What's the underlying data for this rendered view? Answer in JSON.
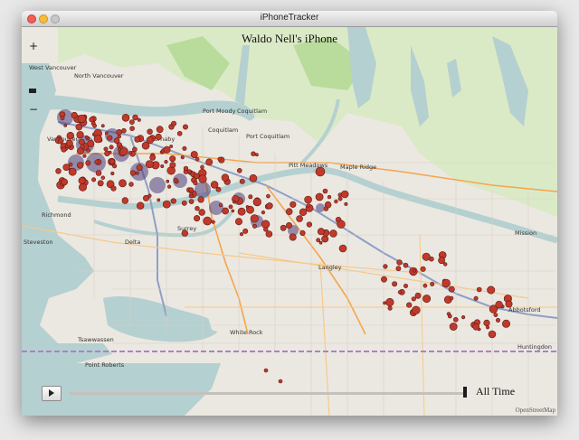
{
  "window": {
    "title": "iPhoneTracker"
  },
  "map": {
    "heading": "Waldo Nell's iPhone",
    "zoom_in_label": "+",
    "zoom_out_label": "−",
    "attribution": "OpenStreetMap",
    "colors": {
      "land": "#ebe8e1",
      "water": "#b5d0d0",
      "park": "#cdebb0",
      "highway": "#8da0c7",
      "trunk": "#f6a44b",
      "border": "#b07dc9",
      "dot_fill": "#c0392b",
      "cluster": "#4c3c7c"
    },
    "place_labels": [
      "Vancouver",
      "North Vancouver",
      "West Vancouver",
      "Burnaby",
      "Coquitlam",
      "Port Moody",
      "Port Coquitlam",
      "Pitt Meadows",
      "Maple Ridge",
      "Richmond",
      "Delta",
      "Surrey",
      "Langley",
      "White Rock",
      "Abbotsford",
      "Mission",
      "Steveston",
      "Tsawwassen",
      "Point Roberts",
      "Huntingdon"
    ]
  },
  "controls": {
    "play_button": "play-icon",
    "time_range_label": "All Time"
  }
}
